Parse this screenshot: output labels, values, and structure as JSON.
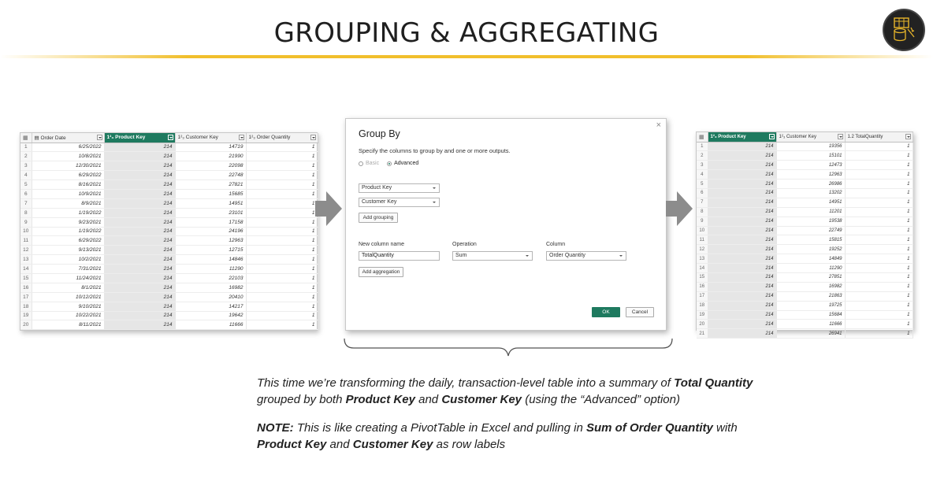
{
  "slide": {
    "title": "GROUPING & AGGREGATING"
  },
  "left_table": {
    "headers": [
      "Order Date",
      "Product Key",
      "Customer Key",
      "Order Quantity"
    ],
    "header_icons": [
      "calendar-icon",
      "integer-type-icon",
      "integer-type-icon",
      "integer-type-icon"
    ],
    "type_glyph": "1²₃",
    "rows": [
      [
        "1",
        "6/25/2022",
        "214",
        "14719",
        "1"
      ],
      [
        "2",
        "10/8/2021",
        "214",
        "21990",
        "1"
      ],
      [
        "3",
        "12/30/2021",
        "214",
        "22098",
        "1"
      ],
      [
        "4",
        "6/29/2022",
        "214",
        "22748",
        "1"
      ],
      [
        "5",
        "8/16/2021",
        "214",
        "27821",
        "1"
      ],
      [
        "6",
        "10/9/2021",
        "214",
        "15685",
        "1"
      ],
      [
        "7",
        "8/9/2021",
        "214",
        "14951",
        "1"
      ],
      [
        "8",
        "1/19/2022",
        "214",
        "23101",
        "1"
      ],
      [
        "9",
        "9/23/2021",
        "214",
        "17158",
        "1"
      ],
      [
        "10",
        "1/19/2022",
        "214",
        "24196",
        "1"
      ],
      [
        "11",
        "6/29/2022",
        "214",
        "12963",
        "1"
      ],
      [
        "12",
        "9/13/2021",
        "214",
        "12715",
        "1"
      ],
      [
        "13",
        "10/2/2021",
        "214",
        "14846",
        "1"
      ],
      [
        "14",
        "7/31/2021",
        "214",
        "11290",
        "1"
      ],
      [
        "15",
        "11/24/2021",
        "214",
        "22103",
        "1"
      ],
      [
        "16",
        "8/1/2021",
        "214",
        "16982",
        "1"
      ],
      [
        "17",
        "10/12/2021",
        "214",
        "20410",
        "1"
      ],
      [
        "18",
        "9/10/2021",
        "214",
        "14217",
        "1"
      ],
      [
        "19",
        "10/22/2021",
        "214",
        "19642",
        "1"
      ],
      [
        "20",
        "8/11/2021",
        "214",
        "11666",
        "1"
      ]
    ]
  },
  "dialog": {
    "title": "Group By",
    "close": "×",
    "subtitle": "Specify the columns to group by and one or more outputs.",
    "radio_basic": "Basic",
    "radio_advanced": "Advanced",
    "group_by_1": "Product Key",
    "group_by_2": "Customer Key",
    "add_grouping": "Add grouping",
    "new_column_label": "New column name",
    "operation_label": "Operation",
    "column_label": "Column",
    "new_column_value": "TotalQuantity",
    "operation_value": "Sum",
    "column_value": "Order Quantity",
    "add_aggregation": "Add aggregation",
    "ok": "OK",
    "cancel": "Cancel"
  },
  "right_table": {
    "headers": [
      "Product Key",
      "Customer Key",
      "TotalQuantity"
    ],
    "type_glyph_int": "1²₃",
    "type_glyph_dec": "1.2",
    "rows": [
      [
        "1",
        "214",
        "19356",
        "1"
      ],
      [
        "2",
        "214",
        "15101",
        "1"
      ],
      [
        "3",
        "214",
        "12473",
        "1"
      ],
      [
        "4",
        "214",
        "12963",
        "1"
      ],
      [
        "5",
        "214",
        "26986",
        "1"
      ],
      [
        "6",
        "214",
        "13202",
        "1"
      ],
      [
        "7",
        "214",
        "14951",
        "1"
      ],
      [
        "8",
        "214",
        "11201",
        "1"
      ],
      [
        "9",
        "214",
        "19538",
        "1"
      ],
      [
        "10",
        "214",
        "22749",
        "1"
      ],
      [
        "11",
        "214",
        "15815",
        "1"
      ],
      [
        "12",
        "214",
        "19252",
        "1"
      ],
      [
        "13",
        "214",
        "14849",
        "1"
      ],
      [
        "14",
        "214",
        "11290",
        "1"
      ],
      [
        "15",
        "214",
        "27851",
        "1"
      ],
      [
        "16",
        "214",
        "16982",
        "1"
      ],
      [
        "17",
        "214",
        "21863",
        "1"
      ],
      [
        "18",
        "214",
        "19725",
        "1"
      ],
      [
        "19",
        "214",
        "15684",
        "1"
      ],
      [
        "20",
        "214",
        "11666",
        "1"
      ],
      [
        "21",
        "214",
        "26941",
        "1"
      ]
    ]
  },
  "captions": {
    "p1_a": "This time we’re transforming the daily, transaction-level table into a summary of ",
    "p1_b": "Total Quantity",
    "p1_c": " grouped by both ",
    "p1_d": "Product Key",
    "p1_e": " and ",
    "p1_f": "Customer Key",
    "p1_g": " (using the “Advanced” option)",
    "p2_a": "NOTE:",
    "p2_b": " This is like creating a PivotTable in Excel and pulling in ",
    "p2_c": "Sum of Order Quantity",
    "p2_d": " with ",
    "p2_e": "Product Key",
    "p2_f": " and ",
    "p2_g": "Customer Key",
    "p2_h": " as row labels"
  },
  "colors": {
    "accent_green": "#1e7a5f",
    "title_underline": "#f1bf2c",
    "arrow_gray": "#8c8c8c"
  }
}
